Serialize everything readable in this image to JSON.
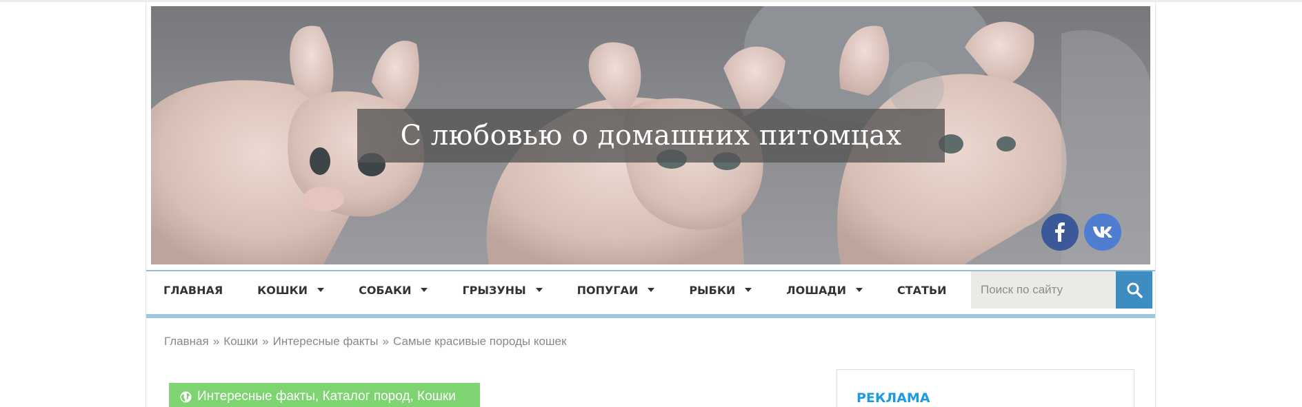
{
  "header": {
    "site_title": "С любовью о домашних питомцах",
    "social": [
      {
        "name": "facebook",
        "glyph": "f"
      },
      {
        "name": "vkontakte",
        "glyph": "vk"
      }
    ]
  },
  "nav": {
    "items": [
      {
        "label": "ГЛАВНАЯ",
        "has_dropdown": false
      },
      {
        "label": "КОШКИ",
        "has_dropdown": true
      },
      {
        "label": "СОБАКИ",
        "has_dropdown": true
      },
      {
        "label": "ГРЫЗУНЫ",
        "has_dropdown": true
      },
      {
        "label": "ПОПУГАИ",
        "has_dropdown": true
      },
      {
        "label": "РЫБКИ",
        "has_dropdown": true
      },
      {
        "label": "ЛОШАДИ",
        "has_dropdown": true
      },
      {
        "label": "СТАТЬИ",
        "has_dropdown": false
      }
    ],
    "search_placeholder": "Поиск по сайту"
  },
  "breadcrumb": {
    "items": [
      "Главная",
      "Кошки",
      "Интересные факты",
      "Самые красивые породы кошек"
    ],
    "separator": "»"
  },
  "post": {
    "categories": "Интересные факты, Каталог пород, Кошки",
    "tag_color": "#7dd470"
  },
  "sidebar": {
    "ad_title": "РЕКЛАМА"
  },
  "colors": {
    "accent": "#3d8dc2",
    "facebook": "#3b5998",
    "vk": "#4f7ed1",
    "ad_title": "#1c9be0"
  }
}
